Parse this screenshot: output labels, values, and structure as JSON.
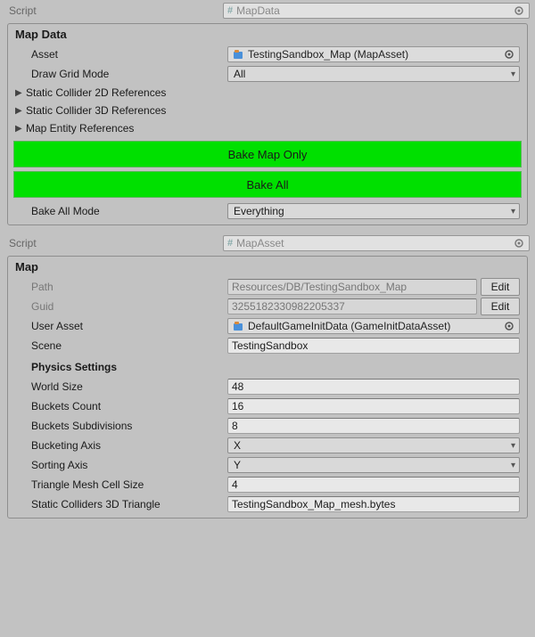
{
  "section1": {
    "script_label": "Script",
    "script_value": "MapData",
    "header": "Map Data",
    "asset_label": "Asset",
    "asset_value": "TestingSandbox_Map (MapAsset)",
    "drawgrid_label": "Draw Grid Mode",
    "drawgrid_value": "All",
    "foldouts": [
      "Static Collider 2D References",
      "Static Collider 3D References",
      "Map Entity References"
    ],
    "btn_bake_map": "Bake Map Only",
    "btn_bake_all": "Bake All",
    "bakeall_label": "Bake All Mode",
    "bakeall_value": "Everything"
  },
  "section2": {
    "script_label": "Script",
    "script_value": "MapAsset",
    "header": "Map",
    "path_label": "Path",
    "path_value": "Resources/DB/TestingSandbox_Map",
    "guid_label": "Guid",
    "guid_value": "3255182330982205337",
    "edit_label": "Edit",
    "userasset_label": "User Asset",
    "userasset_value": "DefaultGameInitData (GameInitDataAsset)",
    "scene_label": "Scene",
    "scene_value": "TestingSandbox",
    "physics_header": "Physics Settings",
    "worldsize_label": "World Size",
    "worldsize_value": "48",
    "buckets_label": "Buckets Count",
    "buckets_value": "16",
    "subdiv_label": "Buckets Subdivisions",
    "subdiv_value": "8",
    "bucketaxis_label": "Bucketing Axis",
    "bucketaxis_value": "X",
    "sortaxis_label": "Sorting Axis",
    "sortaxis_value": "Y",
    "cellsize_label": "Triangle Mesh Cell Size",
    "cellsize_value": "4",
    "statc3d_label": "Static Colliders 3D Triangle",
    "statc3d_value": "TestingSandbox_Map_mesh.bytes"
  }
}
